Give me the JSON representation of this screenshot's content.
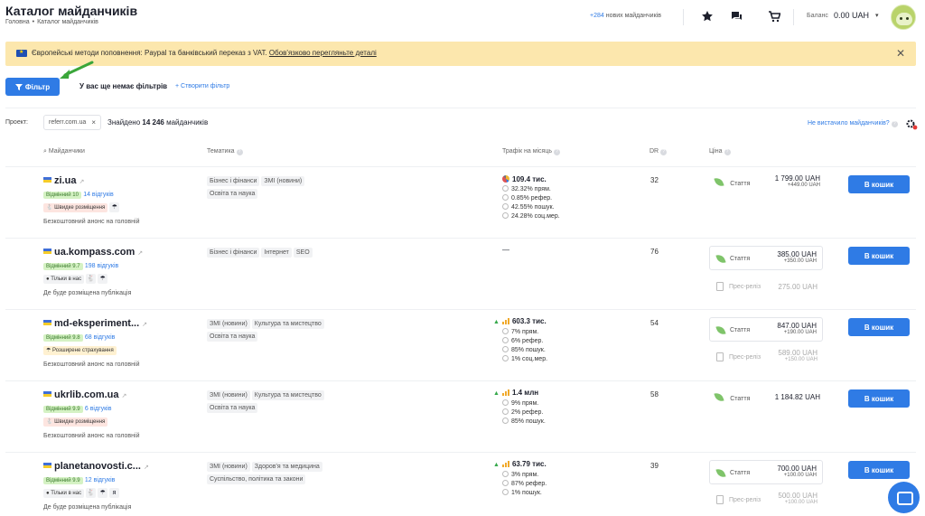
{
  "header": {
    "title": "Каталог майданчиків",
    "breadcrumb": [
      "Головна",
      "Каталог майданчиків"
    ],
    "new_count": "+284",
    "new_label": "нових майданчиків",
    "balance_label": "Баланс",
    "balance_value": "0.00 UAH"
  },
  "notice": {
    "text": "Європейські методи поповнення: Paypal та банківський переказ з VAT.",
    "link": "Обов'язково перегляньте деталі"
  },
  "toolbar": {
    "filter_label": "Фільтр",
    "no_filters": "У вас ще немає фільтрів",
    "create_filter": "Створити фільтр",
    "project_label": "Проект:",
    "project_value": "referr.com.ua",
    "found_prefix": "Знайдено",
    "found_count": "14 246",
    "found_suffix": "майданчиків",
    "not_enough": "Не вистачило майданчиків?"
  },
  "columns": {
    "sites": "Майданчики",
    "topics": "Тематика",
    "traffic": "Трафік на місяць",
    "dr": "DR",
    "price": "Ціна"
  },
  "rows": [
    {
      "name": "zi.ua",
      "rating": "Відмінний 10",
      "reviews": "14 відгуків",
      "badges": [
        "Швидке розміщення"
      ],
      "desc": "Безкоштовний анонс на головній",
      "topics": [
        "Бізнес і фінанси",
        "ЗМІ (новини)",
        "Освіта та наука"
      ],
      "traffic": "109.4 тис.",
      "traffic_lines": [
        "32.32% прям.",
        "0.85% рефер.",
        "42.55% пошук.",
        "24.28% соц.мер."
      ],
      "dr": "32",
      "offer_type": "Стаття",
      "price": "1 799.00 UAH",
      "price_sub": "+449.00 UAH"
    },
    {
      "name": "ua.kompass.com",
      "rating": "Відмінний 9.7",
      "reviews": "198 відгуків",
      "badges": [
        "Тільки в нас"
      ],
      "desc": "Де буде розміщена публікація",
      "topics": [
        "Бізнес і фінанси",
        "Інтернет",
        "SEO"
      ],
      "traffic": "—",
      "traffic_lines": [],
      "dr": "76",
      "offer_type": "Стаття",
      "price": "385.00 UAH",
      "price_sub": "+350.00 UAH",
      "offer2_type": "Прес-реліз",
      "price2": "275.00 UAH",
      "price2_sub": ""
    },
    {
      "name": "md-eksperiment...",
      "rating": "Відмінний 9.8",
      "reviews": "68 відгуків",
      "badges": [
        "Розширене страхування"
      ],
      "desc": "Безкоштовний анонс на головній",
      "topics": [
        "ЗМІ (новини)",
        "Культура та мистецтво",
        "Освіта та наука"
      ],
      "traffic": "603.3 тис.",
      "traffic_lines": [
        "7% прям.",
        "6% рефер.",
        "85% пошук.",
        "1% соц.мер."
      ],
      "dr": "54",
      "offer_type": "Стаття",
      "price": "847.00 UAH",
      "price_sub": "+190.00 UAH",
      "offer2_type": "Прес-реліз",
      "price2": "589.00 UAH",
      "price2_sub": "+150.00 UAH"
    },
    {
      "name": "ukrlib.com.ua",
      "rating": "Відмінний 9.9",
      "reviews": "6 відгуків",
      "badges": [
        "Швидке розміщення"
      ],
      "desc": "Безкоштовний анонс на головній",
      "topics": [
        "ЗМІ (новини)",
        "Культура та мистецтво",
        "Освіта та наука"
      ],
      "traffic": "1.4 млн",
      "traffic_lines": [
        "9% прям.",
        "2% рефер.",
        "85% пошук."
      ],
      "dr": "58",
      "offer_type": "Стаття",
      "price": "1 184.82 UAH",
      "price_sub": ""
    },
    {
      "name": "planetanovosti.c...",
      "rating": "Відмінний 9.9",
      "reviews": "12 відгуків",
      "badges": [
        "Тільки в нас"
      ],
      "desc": "Де буде розміщена публікація",
      "topics": [
        "ЗМІ (новини)",
        "Здоров'я та медицина",
        "Суспільство, політика та закони"
      ],
      "traffic": "63.79 тис.",
      "traffic_lines": [
        "3% прям.",
        "87% рефер.",
        "1% пошук."
      ],
      "dr": "39",
      "offer_type": "Стаття",
      "price": "700.00 UAH",
      "price_sub": "+100.00 UAH",
      "offer2_type": "Прес-реліз",
      "price2": "500.00 UAH",
      "price2_sub": "+100.00 UAH"
    }
  ],
  "cart_label": "В кошик",
  "colors": {
    "accent": "#2f7be5",
    "notice_bg": "#fce7ad",
    "rating_bg": "#d5f2c4"
  }
}
